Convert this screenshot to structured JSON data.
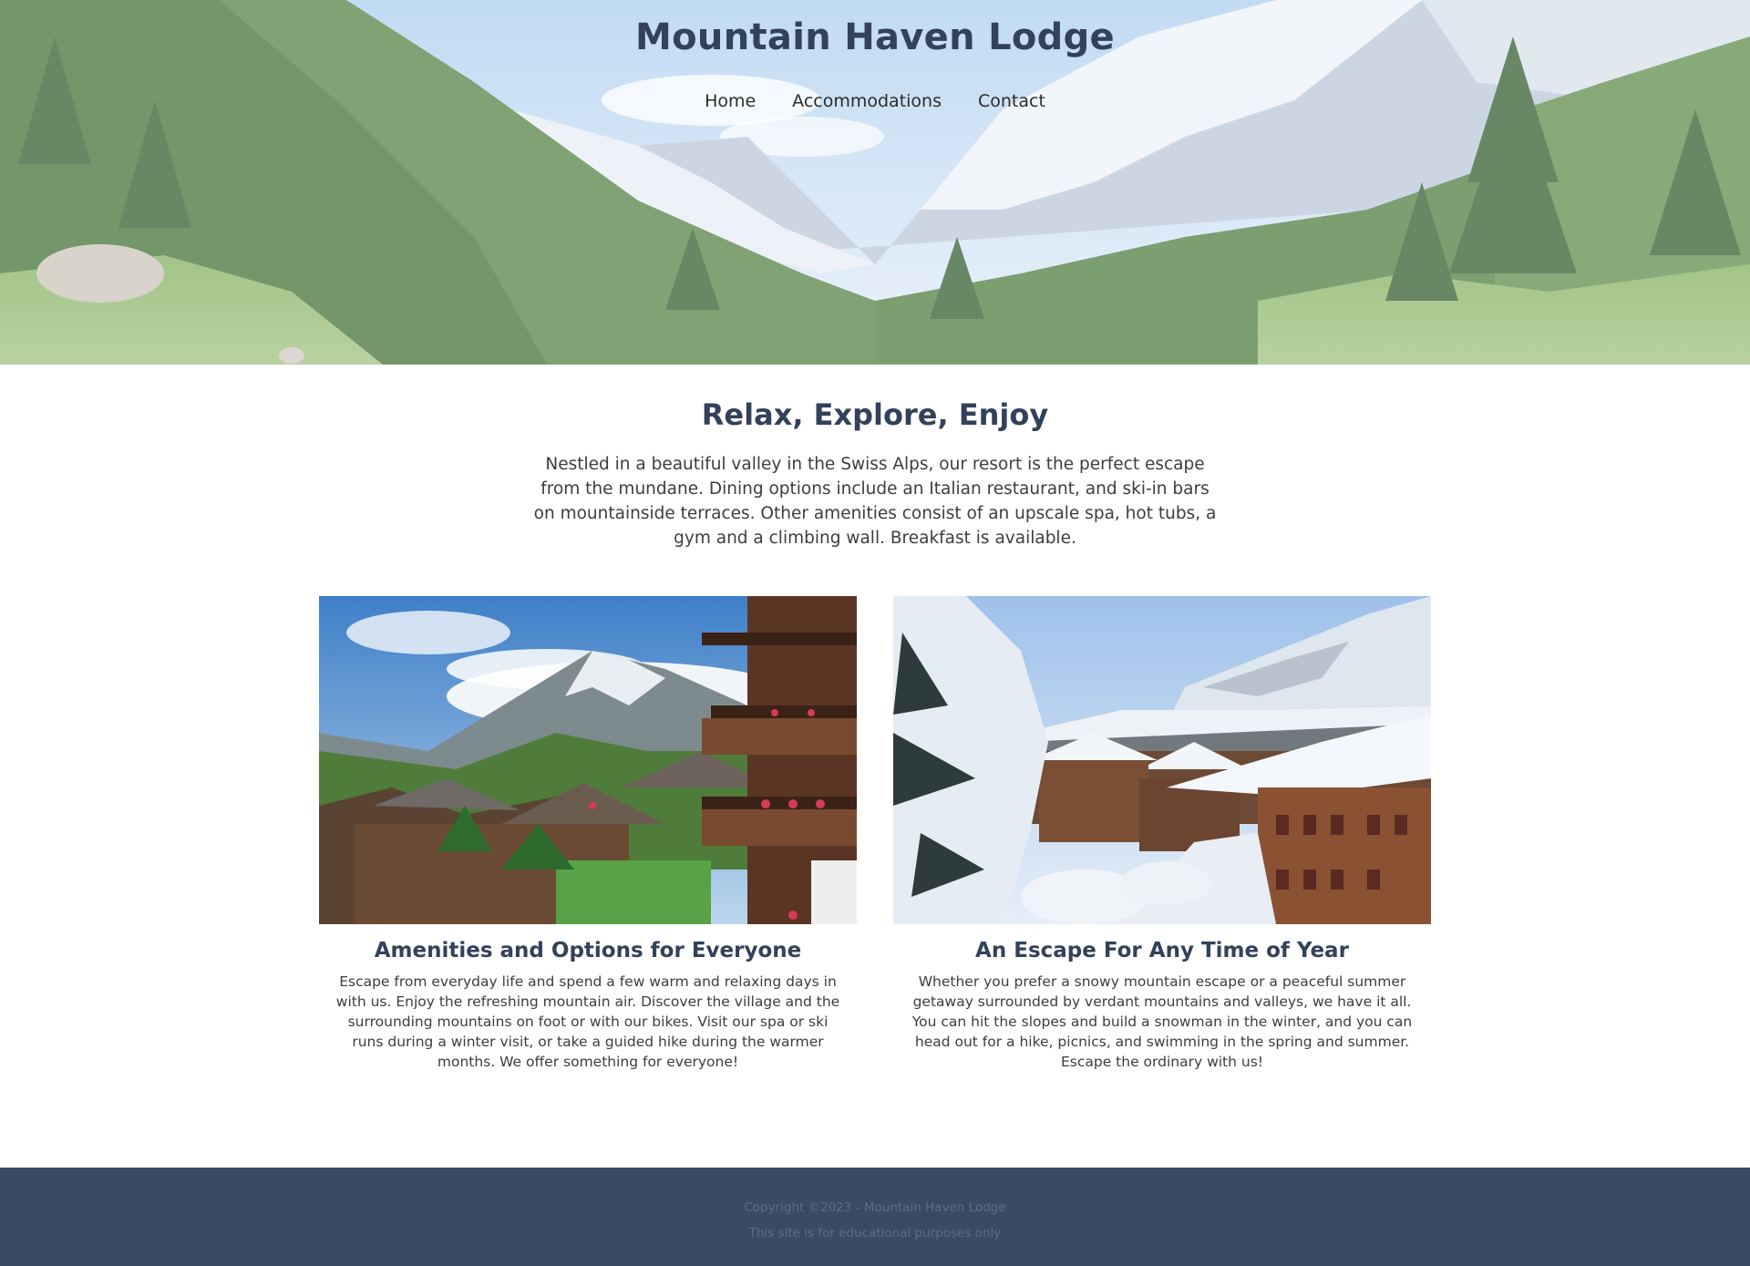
{
  "header": {
    "title": "Mountain Haven Lodge",
    "nav": [
      {
        "label": "Home"
      },
      {
        "label": "Accommodations"
      },
      {
        "label": "Contact"
      }
    ]
  },
  "intro": {
    "heading": "Relax, Explore, Enjoy",
    "text": "Nestled in a beautiful valley in the Swiss Alps, our resort is the perfect escape from the mundane. Dining options include an Italian restaurant, and ski-in bars on mountainside terraces. Other amenities consist of an upscale spa, hot tubs, a gym and a climbing wall. Breakfast is available."
  },
  "cards": [
    {
      "title": "Amenities and Options for Everyone",
      "text": "Escape from everyday life and spend a few warm and relaxing days in with us. Enjoy the refreshing mountain air. Discover the village and the surrounding mountains on foot or with our bikes. Visit our spa or ski runs during a winter visit, or take a guided hike during the warmer months. We offer something for everyone!"
    },
    {
      "title": "An Escape For Any Time of Year",
      "text": "Whether you prefer a snowy mountain escape or a peaceful summer getaway surrounded by verdant mountains and valleys, we have it all. You can hit the slopes and build a snowman in the winter, and you can head out for a hike, picnics, and swimming in the spring and summer. Escape the ordinary with us!"
    }
  ],
  "footer": {
    "copyright": "Copyright ©2023 - Mountain Haven Lodge",
    "note": "This site is for educational purposes only"
  },
  "colors": {
    "heading": "#33415a",
    "footer_bg": "#3a4a63",
    "footer_text": "#5d6c84"
  }
}
